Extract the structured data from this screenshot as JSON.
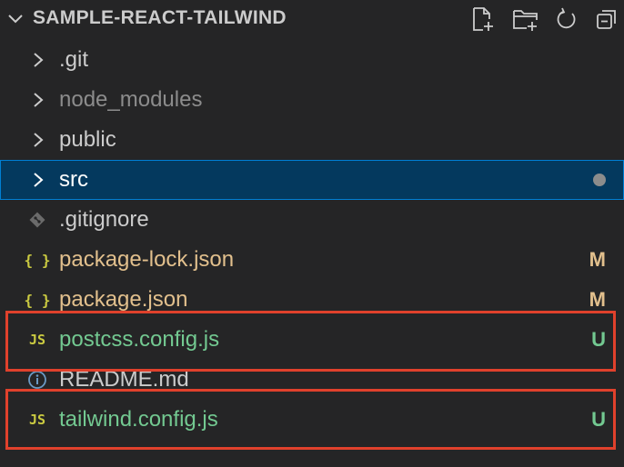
{
  "explorer": {
    "title": "SAMPLE-REACT-TAILWIND",
    "actions": [
      {
        "name": "new-file-icon"
      },
      {
        "name": "new-folder-icon"
      },
      {
        "name": "refresh-icon"
      },
      {
        "name": "collapse-all-icon"
      }
    ]
  },
  "tree": {
    "items": [
      {
        "label": ".git",
        "kind": "folder",
        "status": "",
        "color": "#cccccc"
      },
      {
        "label": "node_modules",
        "kind": "folder",
        "status": "",
        "color": "#8c8c8c"
      },
      {
        "label": "public",
        "kind": "folder",
        "status": "",
        "color": "#cccccc"
      },
      {
        "label": "src",
        "kind": "folder",
        "status": "",
        "color": "#ffffff",
        "selected": true,
        "modified_dot": true
      },
      {
        "label": ".gitignore",
        "kind": "git-file",
        "status": "",
        "color": "#cccccc"
      },
      {
        "label": "package-lock.json",
        "kind": "json-file",
        "status": "M",
        "color": "#e2c08d",
        "status_color": "#e2c08d"
      },
      {
        "label": "package.json",
        "kind": "json-file",
        "status": "M",
        "color": "#e2c08d",
        "status_color": "#e2c08d"
      },
      {
        "label": "postcss.config.js",
        "kind": "js-file",
        "status": "U",
        "color": "#73c991",
        "status_color": "#73c991",
        "highlighted": true
      },
      {
        "label": "README.md",
        "kind": "info-file",
        "status": "",
        "color": "#cccccc"
      },
      {
        "label": "tailwind.config.js",
        "kind": "js-file",
        "status": "U",
        "color": "#73c991",
        "status_color": "#73c991",
        "highlighted": true
      }
    ],
    "icons": {
      "json": "{ }",
      "js": "JS"
    }
  },
  "colors": {
    "background": "#252526",
    "selection_bg": "#04395e",
    "selection_border": "#007fd4",
    "json_icon": "#cbcb41",
    "js_icon": "#cbcb41",
    "highlight_border": "#e0412c"
  }
}
